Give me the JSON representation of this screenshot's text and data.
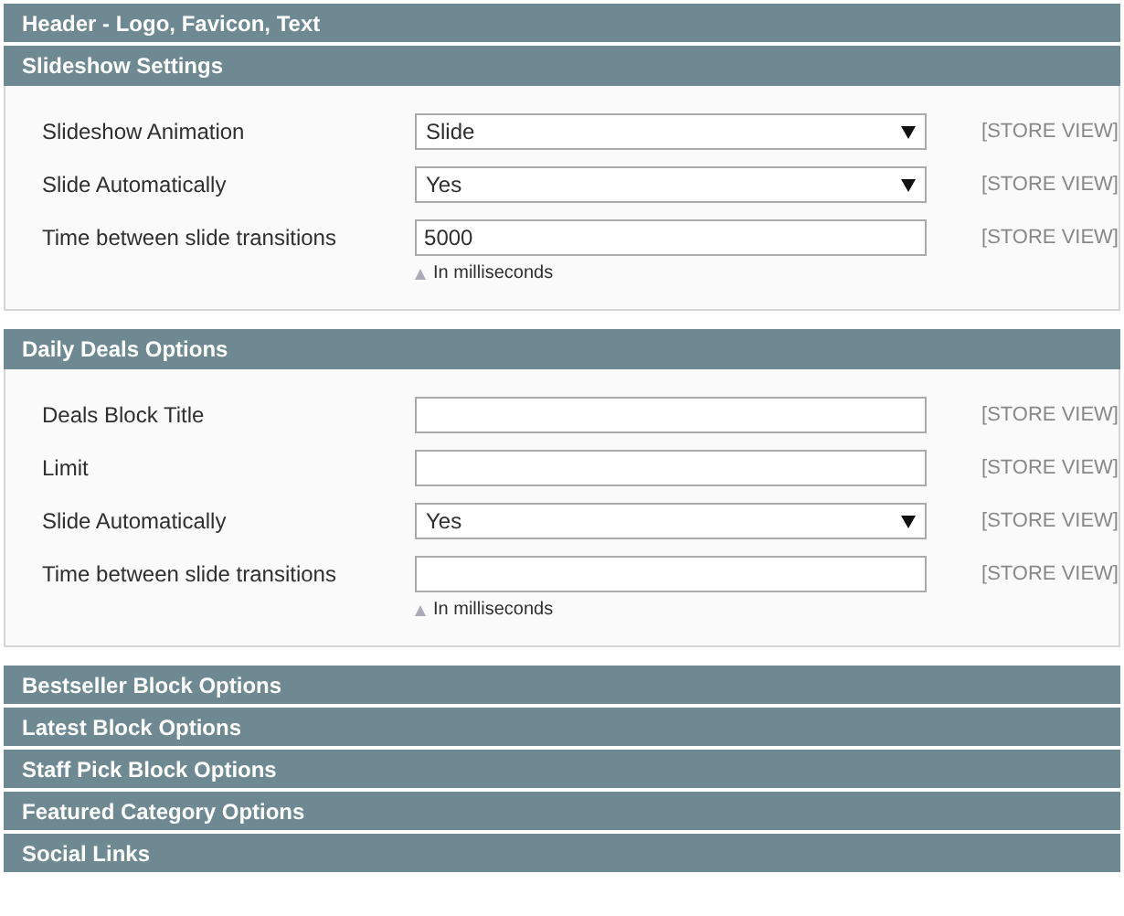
{
  "sections": [
    {
      "title": "Header - Logo, Favicon, Text",
      "expanded": false
    },
    {
      "title": "Slideshow Settings",
      "expanded": true,
      "fields": [
        {
          "label": "Slideshow Animation",
          "kind": "select",
          "value": "Slide",
          "scope": "[STORE VIEW]"
        },
        {
          "label": "Slide Automatically",
          "kind": "select",
          "value": "Yes",
          "scope": "[STORE VIEW]"
        },
        {
          "label": "Time between slide transitions",
          "kind": "text",
          "value": "5000",
          "scope": "[STORE VIEW]",
          "note": "In milliseconds"
        }
      ]
    },
    {
      "title": "Daily Deals Options",
      "expanded": true,
      "fields": [
        {
          "label": "Deals Block Title",
          "kind": "text",
          "scope": "[STORE VIEW]"
        },
        {
          "label": "Limit",
          "kind": "text",
          "scope": "[STORE VIEW]"
        },
        {
          "label": "Slide Automatically",
          "kind": "select",
          "value": "Yes",
          "scope": "[STORE VIEW]"
        },
        {
          "label": "Time between slide transitions",
          "kind": "text",
          "scope": "[STORE VIEW]",
          "note": "In milliseconds"
        }
      ]
    },
    {
      "title": "Bestseller Block Options",
      "expanded": false
    },
    {
      "title": "Latest Block Options",
      "expanded": false
    },
    {
      "title": "Staff Pick Block Options",
      "expanded": false
    },
    {
      "title": "Featured Category Options",
      "expanded": false
    },
    {
      "title": "Social Links",
      "expanded": false
    }
  ]
}
